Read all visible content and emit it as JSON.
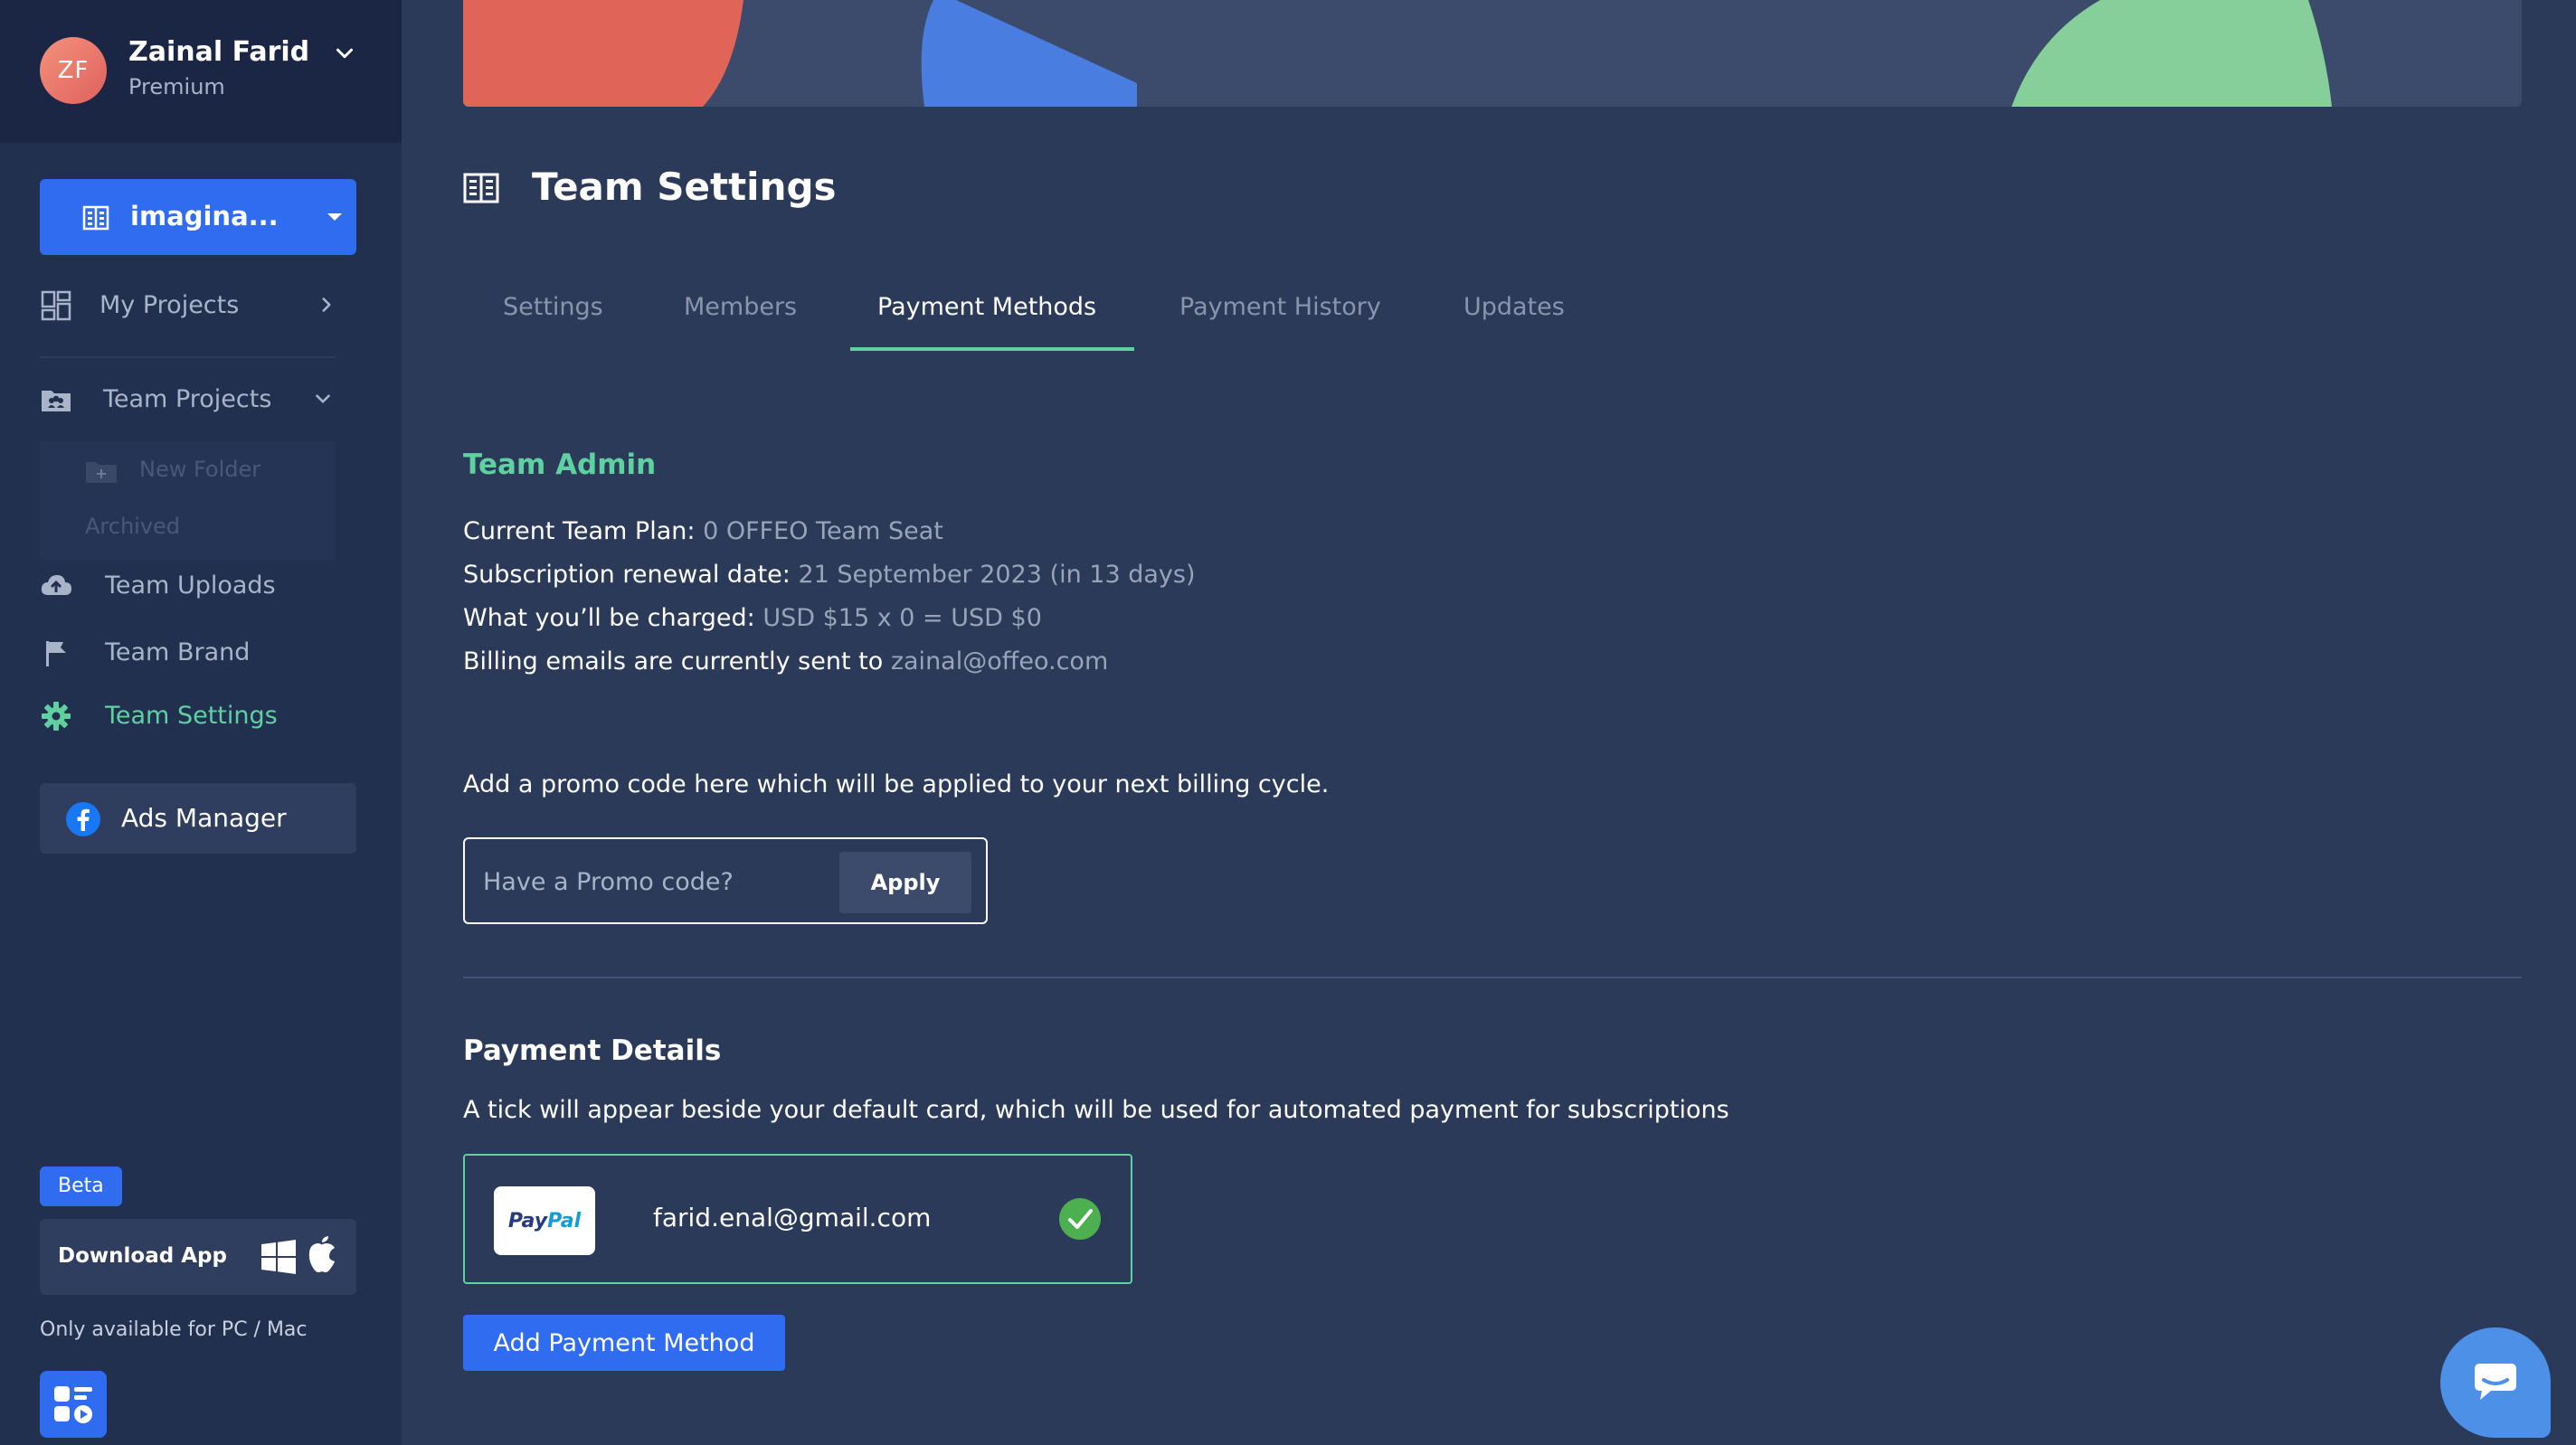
{
  "profile": {
    "initials": "ZF",
    "name": "Zainal Farid",
    "plan": "Premium"
  },
  "workspace": {
    "label": "imagina..."
  },
  "sidebar": {
    "my_projects": "My Projects",
    "team_projects": "Team Projects",
    "new_folder": "New Folder",
    "archived": "Archived",
    "team_uploads": "Team Uploads",
    "team_brand": "Team Brand",
    "team_settings": "Team Settings",
    "ads_manager": "Ads Manager",
    "beta": "Beta",
    "download_app": "Download App",
    "only_available": "Only available for PC / Mac"
  },
  "page": {
    "title": "Team Settings"
  },
  "tabs": [
    {
      "label": "Settings"
    },
    {
      "label": "Members"
    },
    {
      "label": "Payment Methods"
    },
    {
      "label": "Payment History"
    },
    {
      "label": "Updates"
    }
  ],
  "active_tab": "Payment Methods",
  "team_admin": {
    "heading": "Team Admin",
    "plan_label": "Current Team Plan:",
    "plan_value": "0 OFFEO Team Seat",
    "renewal_label": "Subscription renewal date:",
    "renewal_value": "21 September 2023 (in 13 days)",
    "charged_label": "What you’ll be charged:",
    "charged_value": "USD $15 x 0 = USD $0",
    "billing_label": "Billing emails are currently sent to",
    "billing_value": "zainal@offeo.com"
  },
  "promo": {
    "text": "Add a promo code here which will be applied to your next billing cycle.",
    "placeholder": "Have a Promo code?",
    "apply_label": "Apply"
  },
  "payment_details": {
    "heading": "Payment Details",
    "description": "A tick will appear beside your default card, which will be used for automated payment for subscriptions",
    "methods": [
      {
        "provider": "PayPal",
        "email": "farid.enal@gmail.com",
        "is_default": true
      }
    ],
    "add_label": "Add Payment Method"
  },
  "icons": {
    "profile_chevron": "chevron-down-icon",
    "workspace": "building-icon",
    "my_projects": "grid-icon",
    "team_projects": "team-folder-icon",
    "team_uploads": "cloud-upload-icon",
    "team_brand": "flag-icon",
    "team_settings": "gear-icon",
    "ads_manager": "facebook-icon",
    "chat": "chat-icon"
  },
  "colors": {
    "accent_green": "#5fd1a0",
    "accent_blue": "#2f6cf0",
    "background": "#2b3a59",
    "sidebar": "#223050"
  }
}
